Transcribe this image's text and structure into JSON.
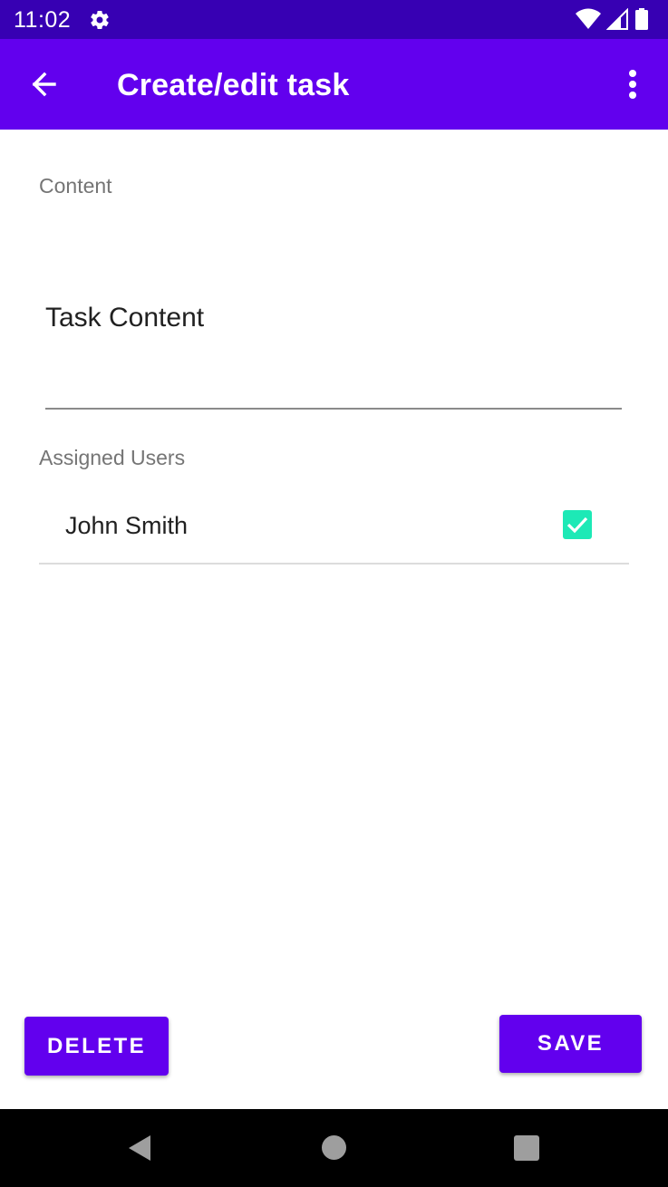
{
  "status_bar": {
    "time": "11:02",
    "icons": [
      "gear-icon",
      "wifi-icon",
      "signal-icon",
      "battery-icon"
    ]
  },
  "app_bar": {
    "title": "Create/edit task",
    "back_icon": "arrow-back-icon",
    "overflow_icon": "more-vert-icon",
    "color": "#6200EE"
  },
  "form": {
    "content_label": "Content",
    "content_value": "Task Content",
    "assigned_label": "Assigned Users",
    "users": [
      {
        "name": "John Smith",
        "checked": true
      }
    ]
  },
  "actions": {
    "delete_label": "DELETE",
    "save_label": "SAVE"
  },
  "colors": {
    "status_bar": "#3700B3",
    "primary": "#6200EE",
    "checkbox": "#1DE9B6"
  },
  "nav_bar": {
    "icons": [
      "nav-back-icon",
      "nav-home-icon",
      "nav-recents-icon"
    ]
  }
}
